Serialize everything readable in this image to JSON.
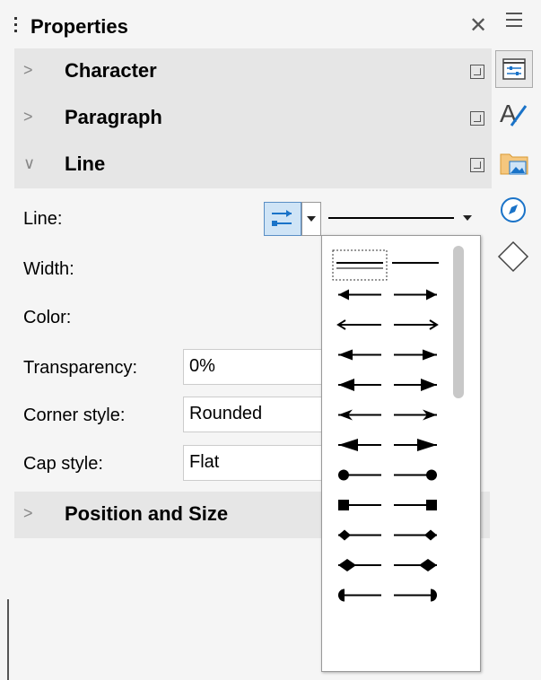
{
  "panel": {
    "title": "Properties",
    "close_icon": "close-icon",
    "menu_icon": "hamburger-menu-icon"
  },
  "sections": [
    {
      "label": "Character",
      "expanded": false
    },
    {
      "label": "Paragraph",
      "expanded": false
    },
    {
      "label": "Line",
      "expanded": true
    },
    {
      "label": "Position and Size",
      "expanded": false
    }
  ],
  "line": {
    "line_label": "Line:",
    "width_label": "Width:",
    "color_label": "Color:",
    "transparency_label": "Transparency:",
    "transparency_value": "0%",
    "corner_label": "Corner style:",
    "corner_value": "Rounded",
    "cap_label": "Cap style:",
    "cap_value": "Flat"
  },
  "sidebar_tabs": [
    {
      "icon": "properties-icon",
      "active": true
    },
    {
      "icon": "styles-icon",
      "active": false
    },
    {
      "icon": "gallery-icon",
      "active": false
    },
    {
      "icon": "navigator-icon",
      "active": false
    },
    {
      "icon": "shapes-icon",
      "active": false
    }
  ],
  "arrow_styles": [
    {
      "start": "none",
      "end": "none"
    },
    {
      "start": "arrow",
      "end": "arrow"
    },
    {
      "start": "thin-arrow",
      "end": "thin-arrow"
    },
    {
      "start": "arrow-large",
      "end": "arrow-large"
    },
    {
      "start": "triangle",
      "end": "triangle"
    },
    {
      "start": "arrow-notched",
      "end": "arrow-notched"
    },
    {
      "start": "triangle-large",
      "end": "triangle-large"
    },
    {
      "start": "circle",
      "end": "circle"
    },
    {
      "start": "square",
      "end": "square"
    },
    {
      "start": "diamond",
      "end": "diamond"
    },
    {
      "start": "diamond-large",
      "end": "diamond-large"
    },
    {
      "start": "half-circle",
      "end": "half-circle"
    }
  ],
  "colors": {
    "accent": "#5a8fc5",
    "section_bg": "#e6e6e6",
    "panel_bg": "#f5f5f5"
  }
}
